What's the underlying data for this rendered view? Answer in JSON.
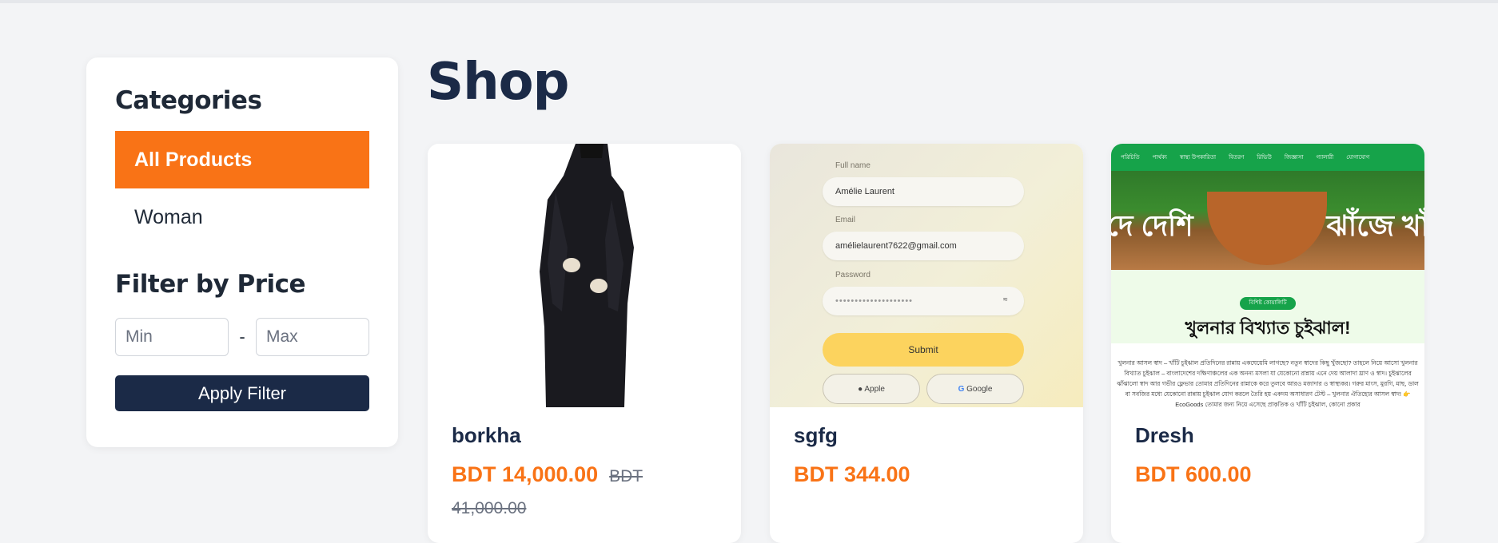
{
  "sidebar": {
    "categories_title": "Categories",
    "categories": [
      {
        "label": "All Products",
        "active": true
      },
      {
        "label": "Woman",
        "active": false
      }
    ],
    "price_title": "Filter by Price",
    "min_placeholder": "Min",
    "max_placeholder": "Max",
    "separator": "-",
    "apply_label": "Apply Filter"
  },
  "main": {
    "title": "Shop",
    "products": [
      {
        "name": "borkha",
        "price": "BDT 14,000.00",
        "old_price": "BDT 41,000.00"
      },
      {
        "name": "sgfg",
        "price": "BDT 344.00"
      },
      {
        "name": "Dresh",
        "price": "BDT 600.00"
      }
    ]
  },
  "form_mockup": {
    "full_name_label": "Full name",
    "full_name_value": "Amélie Laurent",
    "email_label": "Email",
    "email_value": "amélielaurent7622@gmail.com",
    "password_label": "Password",
    "password_value": "••••••••••••••••••••",
    "submit_label": "Submit",
    "apple_label": "Apple",
    "google_label": "Google"
  },
  "banner_mockup": {
    "nav_items": [
      "পরিচিতি",
      "পার্থক্য",
      "স্বাস্থ্য উপকারিতা",
      "বিতরণ",
      "রিভিউ",
      "জিজ্ঞাসা",
      "গ্যালারী",
      "যোগাযোগ"
    ],
    "hero_left": "দে দেশি",
    "hero_right": "ঝাঁজে খাঁ",
    "badge": "বিশিষ্ট কোয়ালিটি",
    "heading": "খুলনার বিখ্যাত চুইঝাল!",
    "paragraph": "খুলনার আসল স্বাদ – খাঁটি চুইঝাল প্রতিদিনের রান্নায় একঘেয়েমি লাগছে? নতুন স্বাদের কিছু খুঁজছো? তাহলে নিয়ে আসো খুলনার বিখ্যাত চুইঝাল – বাংলাদেশের দক্ষিণাঞ্চলের এক অনন্য মসলা যা যেকোনো রান্নায় এনে দেয় আলাদা ঘ্রাণ ও স্বাদ। চুইঝালের ঝাঁঝালো স্বাদ আর গভীর ফ্লেভার তোমার প্রতিদিনের রান্নাকে করে তুলবে আরও মজাদার ও স্বাস্থ্যকর। গরুর মাংস, মুরগি, মাছ, ডাল বা সবজির মধ্যে যেকোনো রান্নায় চুইঝাল যোগ করলে তৈরি হয় একদম অসাধারণ টেস্ট – খুলনার ঐতিহ্যের আসল স্বাদ! 👉 EcoGoods তোমার জন্য নিয়ে এসেছে প্রাকৃতিক ও খাঁটি চুইঝাল, কোনো প্রকার"
  },
  "colors": {
    "accent": "#f97316",
    "navy": "#1b2a47",
    "background": "#f3f4f6",
    "banner_green": "#16a34a"
  }
}
